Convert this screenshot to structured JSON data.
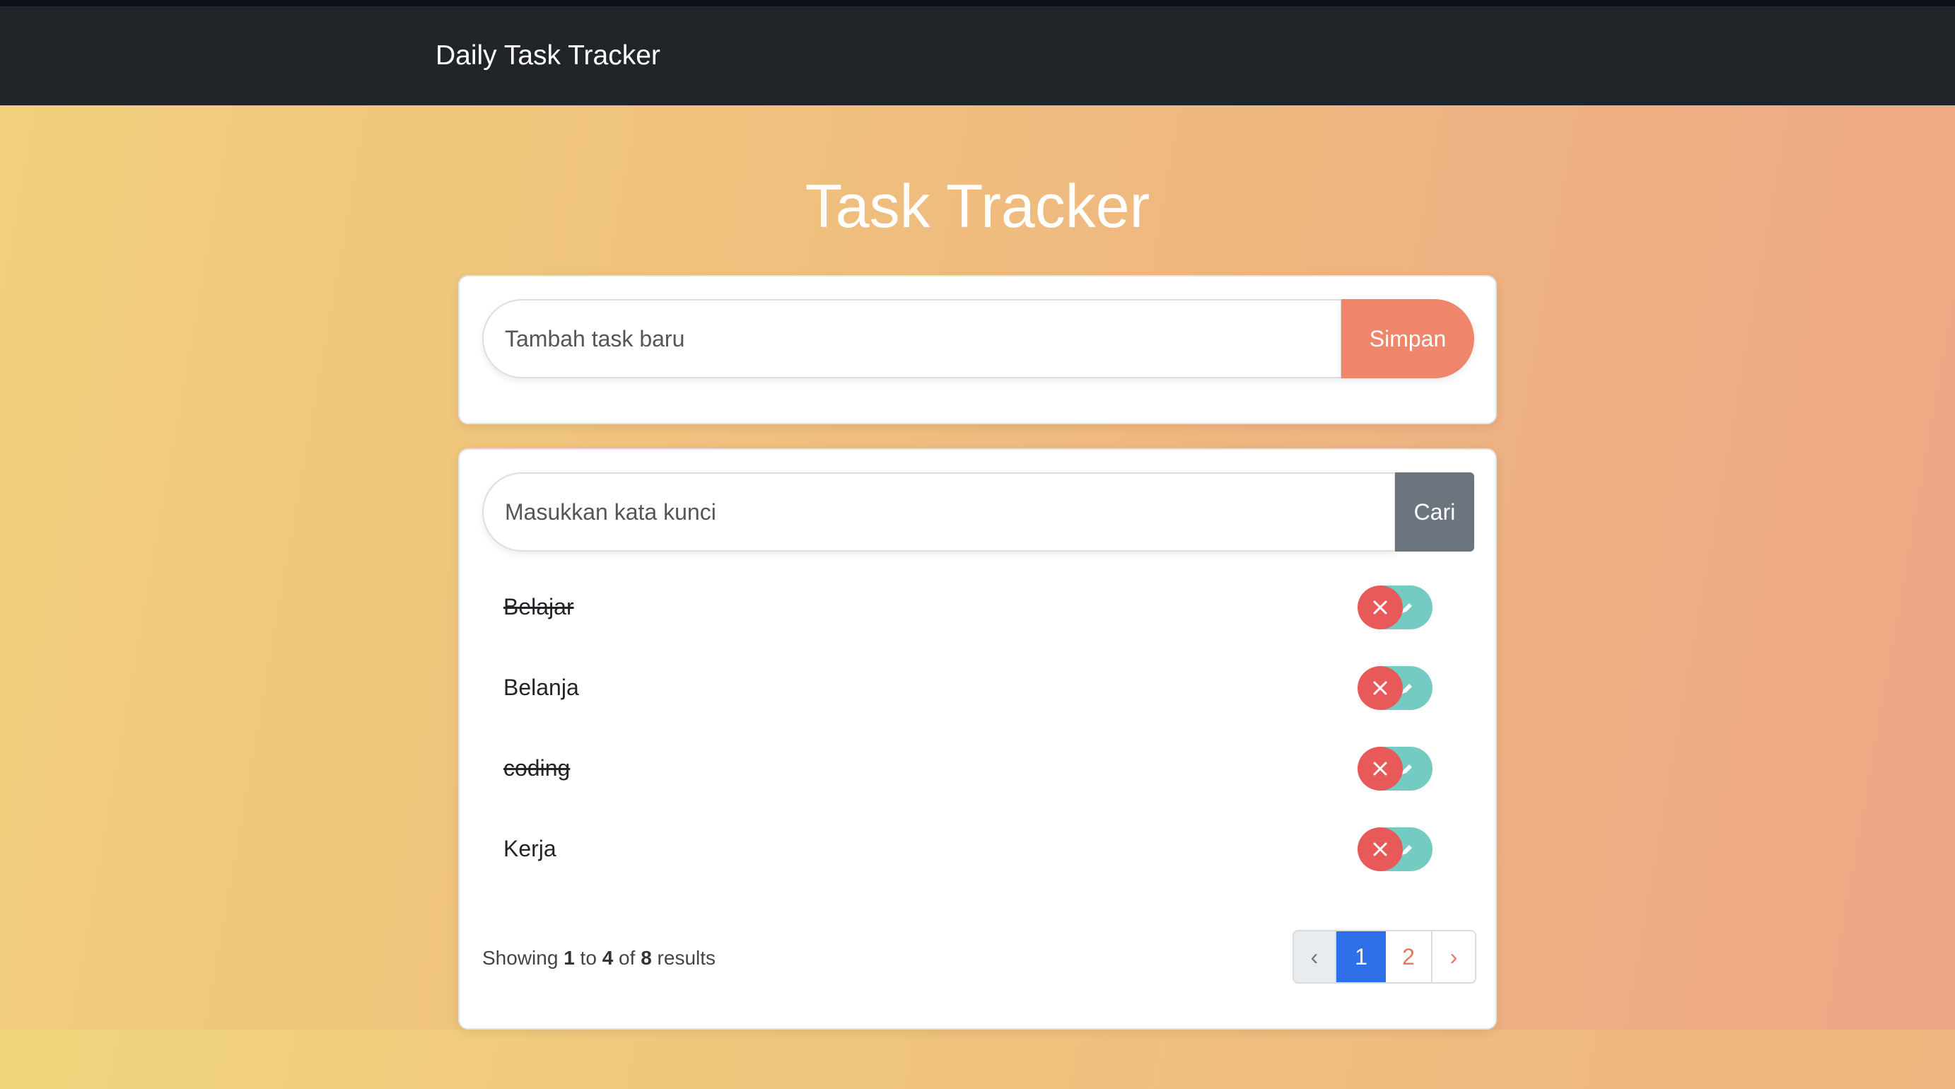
{
  "navbar": {
    "brand": "Daily Task Tracker"
  },
  "page": {
    "title": "Task Tracker"
  },
  "add_form": {
    "placeholder": "Tambah task baru",
    "button_label": "Simpan"
  },
  "search_form": {
    "placeholder": "Masukkan kata kunci",
    "button_label": "Cari"
  },
  "tasks": [
    {
      "name": "Belajar",
      "done": true
    },
    {
      "name": "Belanja",
      "done": false
    },
    {
      "name": "coding",
      "done": true
    },
    {
      "name": "Kerja",
      "done": false
    }
  ],
  "results": {
    "prefix": "Showing",
    "from": "1",
    "to_word": "to",
    "to": "4",
    "of_word": "of",
    "total": "8",
    "suffix": "results"
  },
  "pagination": {
    "prev": "‹",
    "pages": [
      "1",
      "2"
    ],
    "current": "1",
    "next": "›"
  },
  "icons": {
    "delete": "close-icon",
    "edit": "pencil-icon"
  },
  "colors": {
    "navbar": "#212529",
    "save_button": "#ef866b",
    "search_button": "#6c757d",
    "delete_button": "#e85a59",
    "edit_button": "#73cbc1",
    "active_page": "#2f6fe9"
  }
}
